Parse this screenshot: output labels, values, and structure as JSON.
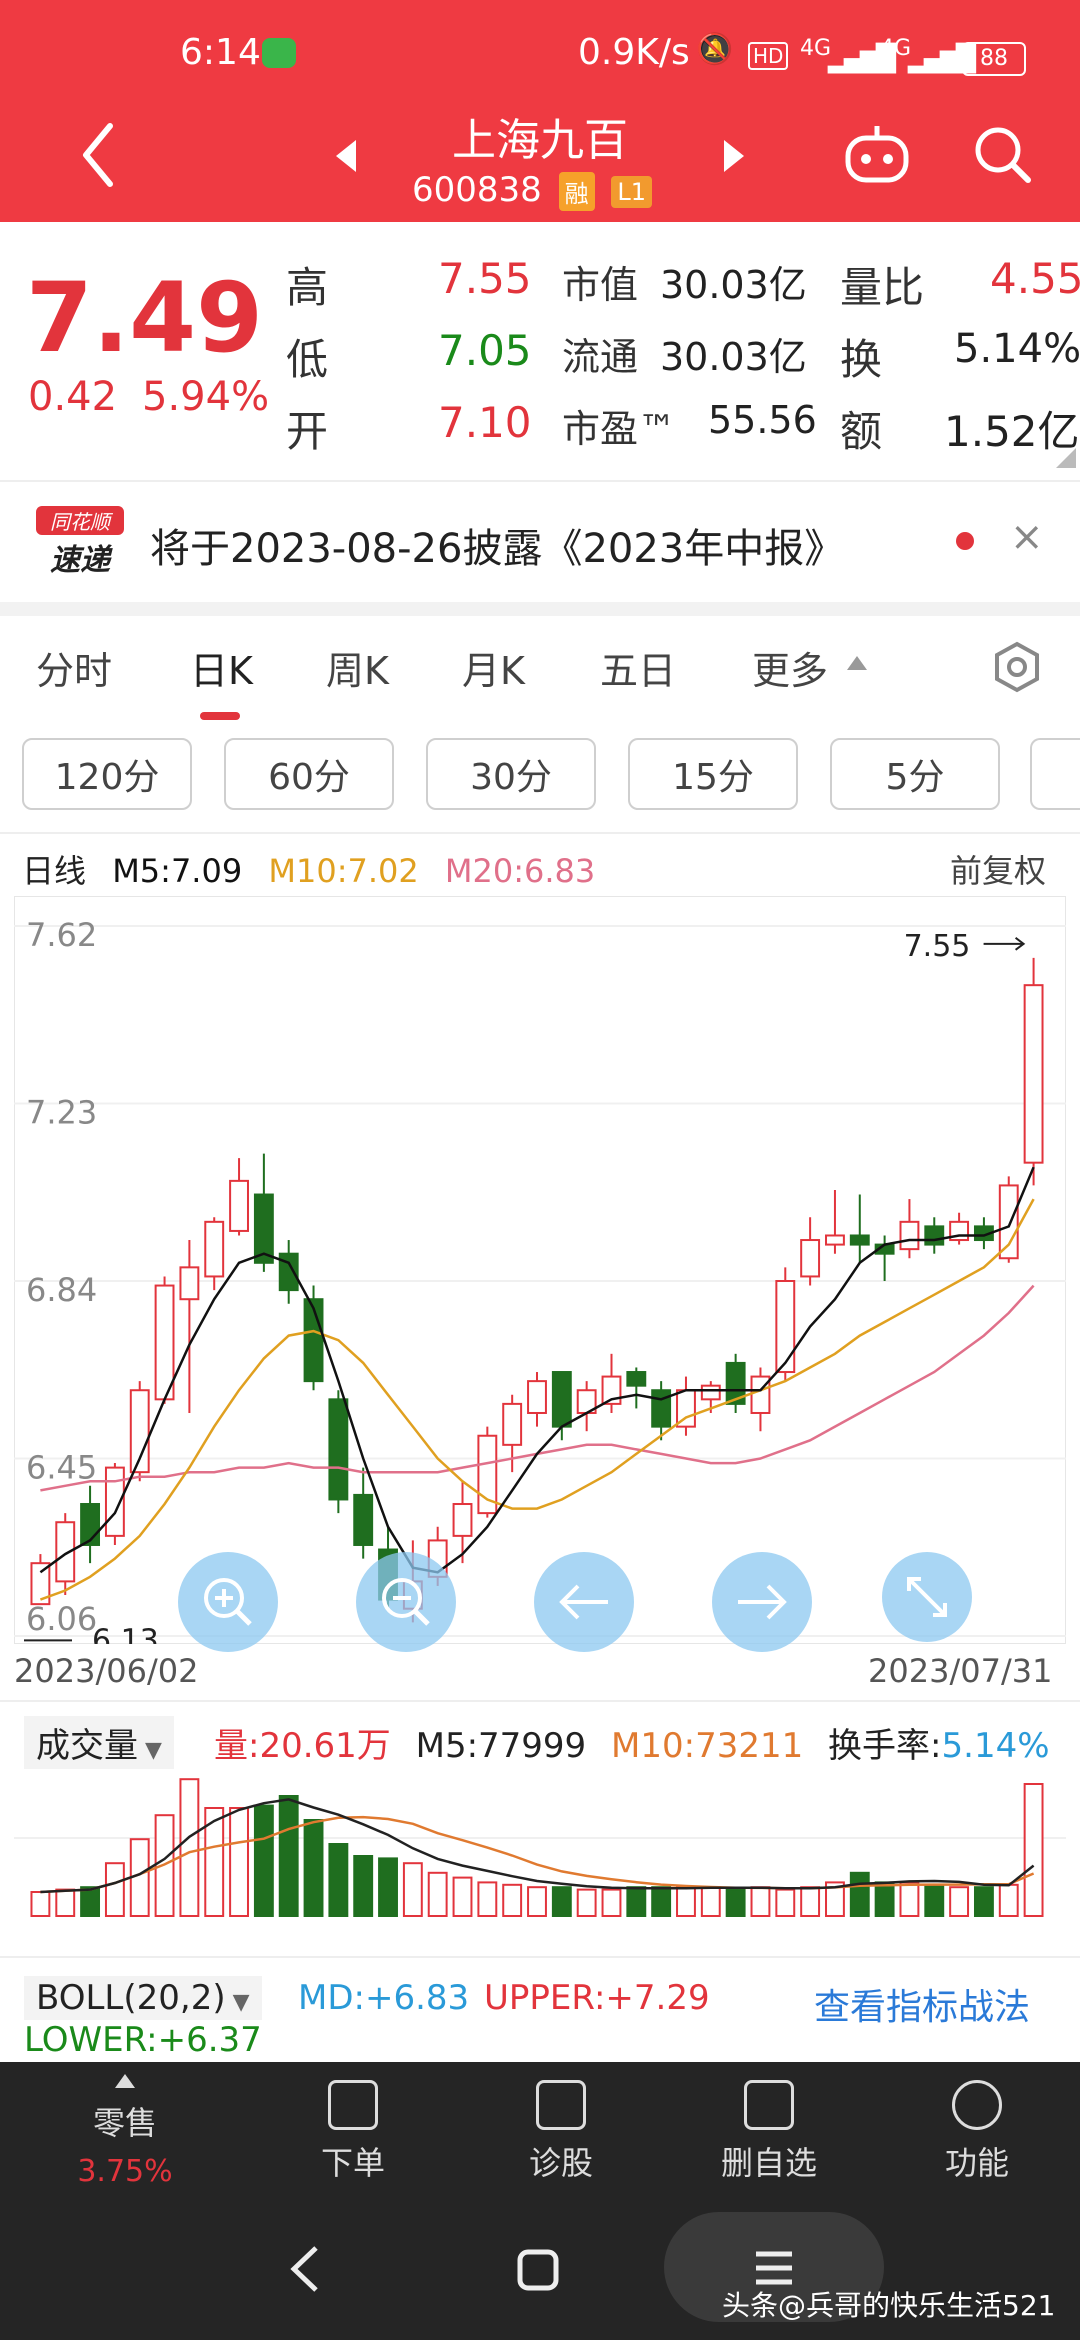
{
  "status_bar": {
    "time": "6:14",
    "net_speed": "0.9K/s",
    "network_1": "4G",
    "network_2": "4G",
    "battery": "88"
  },
  "header": {
    "stock_name": "上海九百",
    "stock_code": "600838",
    "tag_margin": "融",
    "tag_level": "L1"
  },
  "quote": {
    "price": "7.49",
    "change": "0.42",
    "change_pct": "5.94%",
    "fields": [
      {
        "label": "高",
        "value": "7.55"
      },
      {
        "label": "低",
        "value": "7.05"
      },
      {
        "label": "开",
        "value": "7.10"
      },
      {
        "label": "市值",
        "value": "30.03亿"
      },
      {
        "label": "流通",
        "value": "30.03亿"
      },
      {
        "label": "市盈™",
        "value": "55.56"
      },
      {
        "label": "量比",
        "value": "4.55"
      },
      {
        "label": "换",
        "value": "5.14%"
      },
      {
        "label": "额",
        "value": "1.52亿"
      }
    ]
  },
  "news": {
    "badge_top": "同花顺",
    "badge_bottom": "速递",
    "text": "将于2023-08-26披露《2023年中报》"
  },
  "tabs": [
    "分时",
    "日K",
    "周K",
    "月K",
    "五日",
    "更多"
  ],
  "intervals": [
    "120分",
    "60分",
    "30分",
    "15分",
    "5分"
  ],
  "kline": {
    "title": "日线",
    "ma5": "M5:7.09",
    "ma10": "M10:7.02",
    "ma20": "M20:6.83",
    "adjust": "前复权",
    "high_label": "7.55",
    "low_label": "6.13",
    "start_date": "2023/06/02",
    "end_date": "2023/07/31"
  },
  "volume": {
    "selector": "成交量",
    "vol": "量:20.61万",
    "m5": "M5:77999",
    "m10": "M10:73211",
    "turnover_label": "换手率:",
    "turnover_value": "5.14%"
  },
  "boll": {
    "selector": "BOLL(20,2)",
    "md": "MD:+6.83",
    "upper": "UPPER:+7.29",
    "lower": "LOWER:+6.37",
    "link": "查看指标战法"
  },
  "bottom_nav": [
    {
      "label": "零售",
      "sub": "3.75%"
    },
    {
      "label": "下单"
    },
    {
      "label": "诊股"
    },
    {
      "label": "删自选"
    },
    {
      "label": "功能"
    }
  ],
  "watermark": "头条@兵哥的快乐生活521",
  "chart_data": {
    "type": "candlestick",
    "title": "",
    "xlabel": "",
    "ylabel": "",
    "ylim": [
      6.06,
      7.62
    ],
    "y_ticks": [
      "7.62",
      "7.23",
      "6.84",
      "6.45",
      "6.06"
    ],
    "x_range": [
      "2023/06/02",
      "2023/07/31"
    ],
    "colors": {
      "up": "#e2343c",
      "down": "#1f6e1f",
      "ma5": "#111111",
      "ma10": "#e0a020",
      "ma20": "#e0708a"
    },
    "candles": [
      {
        "o": 6.13,
        "c": 6.22,
        "h": 6.24,
        "l": 6.13
      },
      {
        "o": 6.18,
        "c": 6.31,
        "h": 6.33,
        "l": 6.15
      },
      {
        "o": 6.35,
        "c": 6.26,
        "h": 6.39,
        "l": 6.22
      },
      {
        "o": 6.28,
        "c": 6.43,
        "h": 6.44,
        "l": 6.26
      },
      {
        "o": 6.42,
        "c": 6.6,
        "h": 6.62,
        "l": 6.4
      },
      {
        "o": 6.58,
        "c": 6.83,
        "h": 6.85,
        "l": 6.57
      },
      {
        "o": 6.8,
        "c": 6.87,
        "h": 6.93,
        "l": 6.55
      },
      {
        "o": 6.85,
        "c": 6.97,
        "h": 6.98,
        "l": 6.82
      },
      {
        "o": 6.95,
        "c": 7.06,
        "h": 7.11,
        "l": 6.94
      },
      {
        "o": 7.03,
        "c": 6.88,
        "h": 7.12,
        "l": 6.86
      },
      {
        "o": 6.9,
        "c": 6.82,
        "h": 6.93,
        "l": 6.79
      },
      {
        "o": 6.8,
        "c": 6.62,
        "h": 6.83,
        "l": 6.6
      },
      {
        "o": 6.58,
        "c": 6.36,
        "h": 6.6,
        "l": 6.33
      },
      {
        "o": 6.37,
        "c": 6.26,
        "h": 6.43,
        "l": 6.23
      },
      {
        "o": 6.25,
        "c": 6.14,
        "h": 6.3,
        "l": 6.12
      },
      {
        "o": 6.12,
        "c": 6.18,
        "h": 6.27,
        "l": 6.09
      },
      {
        "o": 6.19,
        "c": 6.27,
        "h": 6.3,
        "l": 6.17
      },
      {
        "o": 6.28,
        "c": 6.35,
        "h": 6.4,
        "l": 6.22
      },
      {
        "o": 6.33,
        "c": 6.5,
        "h": 6.52,
        "l": 6.32
      },
      {
        "o": 6.48,
        "c": 6.57,
        "h": 6.59,
        "l": 6.42
      },
      {
        "o": 6.55,
        "c": 6.62,
        "h": 6.64,
        "l": 6.52
      },
      {
        "o": 6.64,
        "c": 6.52,
        "h": 6.64,
        "l": 6.49
      },
      {
        "o": 6.55,
        "c": 6.6,
        "h": 6.62,
        "l": 6.51
      },
      {
        "o": 6.57,
        "c": 6.63,
        "h": 6.68,
        "l": 6.55
      },
      {
        "o": 6.64,
        "c": 6.61,
        "h": 6.65,
        "l": 6.56
      },
      {
        "o": 6.6,
        "c": 6.52,
        "h": 6.62,
        "l": 6.49
      },
      {
        "o": 6.52,
        "c": 6.6,
        "h": 6.63,
        "l": 6.5
      },
      {
        "o": 6.58,
        "c": 6.61,
        "h": 6.62,
        "l": 6.55
      },
      {
        "o": 6.66,
        "c": 6.57,
        "h": 6.68,
        "l": 6.55
      },
      {
        "o": 6.55,
        "c": 6.63,
        "h": 6.65,
        "l": 6.51
      },
      {
        "o": 6.64,
        "c": 6.84,
        "h": 6.87,
        "l": 6.62
      },
      {
        "o": 6.85,
        "c": 6.93,
        "h": 6.98,
        "l": 6.83
      },
      {
        "o": 6.92,
        "c": 6.94,
        "h": 7.04,
        "l": 6.9
      },
      {
        "o": 6.94,
        "c": 6.92,
        "h": 7.03,
        "l": 6.88
      },
      {
        "o": 6.92,
        "c": 6.9,
        "h": 6.94,
        "l": 6.84
      },
      {
        "o": 6.91,
        "c": 6.97,
        "h": 7.02,
        "l": 6.89
      },
      {
        "o": 6.96,
        "c": 6.92,
        "h": 6.98,
        "l": 6.9
      },
      {
        "o": 6.93,
        "c": 6.97,
        "h": 6.99,
        "l": 6.92
      },
      {
        "o": 6.96,
        "c": 6.93,
        "h": 6.98,
        "l": 6.91
      },
      {
        "o": 6.89,
        "c": 7.05,
        "h": 7.07,
        "l": 6.88
      },
      {
        "o": 7.1,
        "c": 7.49,
        "h": 7.55,
        "l": 7.05
      }
    ],
    "ma5": [
      6.2,
      6.24,
      6.27,
      6.33,
      6.45,
      6.58,
      6.7,
      6.8,
      6.88,
      6.9,
      6.88,
      6.78,
      6.62,
      6.45,
      6.3,
      6.21,
      6.2,
      6.24,
      6.3,
      6.38,
      6.46,
      6.52,
      6.55,
      6.58,
      6.59,
      6.58,
      6.6,
      6.6,
      6.6,
      6.6,
      6.66,
      6.74,
      6.8,
      6.88,
      6.92,
      6.93,
      6.93,
      6.94,
      6.94,
      6.96,
      7.09
    ],
    "ma10": [
      6.14,
      6.16,
      6.19,
      6.23,
      6.28,
      6.35,
      6.43,
      6.52,
      6.6,
      6.67,
      6.72,
      6.73,
      6.71,
      6.66,
      6.59,
      6.52,
      6.45,
      6.4,
      6.36,
      6.34,
      6.34,
      6.36,
      6.39,
      6.42,
      6.46,
      6.5,
      6.54,
      6.56,
      6.58,
      6.6,
      6.62,
      6.65,
      6.68,
      6.72,
      6.75,
      6.78,
      6.81,
      6.84,
      6.87,
      6.92,
      7.02
    ],
    "ma20": [
      6.38,
      6.39,
      6.4,
      6.4,
      6.41,
      6.41,
      6.42,
      6.42,
      6.43,
      6.43,
      6.44,
      6.43,
      6.43,
      6.42,
      6.42,
      6.42,
      6.42,
      6.43,
      6.44,
      6.45,
      6.46,
      6.47,
      6.48,
      6.48,
      6.47,
      6.46,
      6.45,
      6.44,
      6.44,
      6.45,
      6.47,
      6.49,
      6.52,
      6.55,
      6.58,
      6.61,
      6.64,
      6.68,
      6.72,
      6.77,
      6.83
    ],
    "volume": [
      10,
      11,
      12,
      22,
      32,
      42,
      57,
      45,
      45,
      46,
      50,
      40,
      30,
      25,
      24,
      22,
      18,
      16,
      14,
      13,
      12,
      12,
      11,
      11,
      12,
      12,
      12,
      12,
      11,
      12,
      11,
      12,
      14,
      18,
      14,
      14,
      13,
      12,
      12,
      13,
      55
    ],
    "volume_ylim": [
      0,
      60
    ]
  }
}
